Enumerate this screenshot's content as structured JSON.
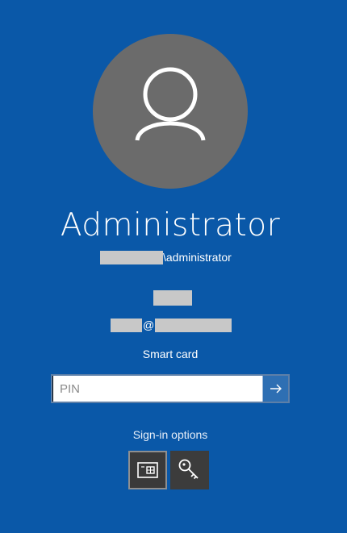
{
  "user": {
    "name": "Administrator",
    "account_suffix": "\\administrator",
    "email_at": "@"
  },
  "signin": {
    "provider_label": "Smart card",
    "pin_placeholder": "PIN",
    "options_label": "Sign-in options"
  },
  "icons": {
    "avatar": "user-silhouette-icon",
    "submit": "arrow-right-icon",
    "smart_card": "smart-card-icon",
    "password": "key-icon"
  },
  "colors": {
    "background": "#0a58a8",
    "avatar": "#6b6b6b",
    "submit_button": "#2e6fb3",
    "option_tile": "#3c3c3c"
  }
}
